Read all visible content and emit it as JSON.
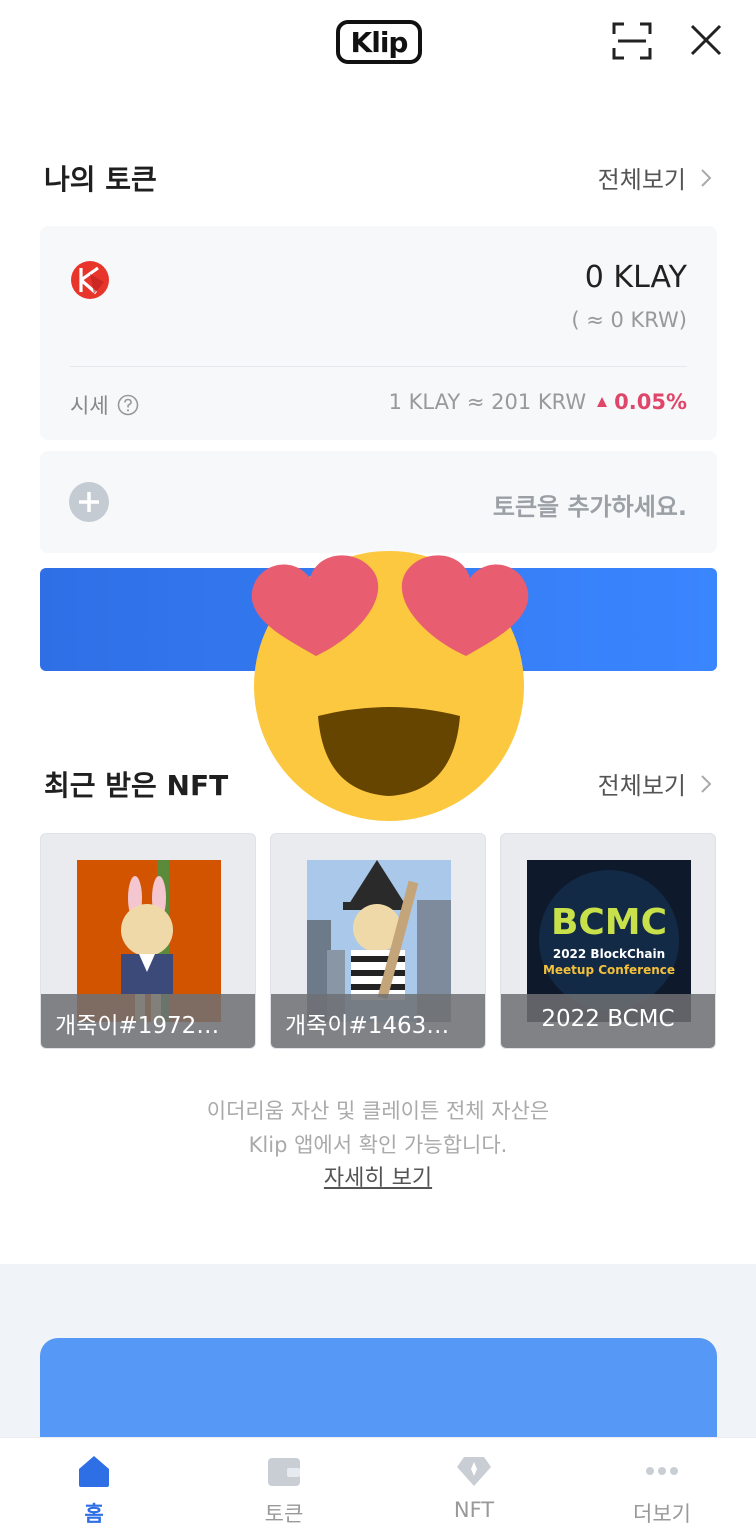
{
  "header": {
    "logo_text": "Klip",
    "scan_icon": "scan-frame-icon",
    "close_icon": "close-icon"
  },
  "tokens": {
    "title": "나의 토큰",
    "see_all": "전체보기",
    "klay": {
      "amount": "0 KLAY",
      "krw": "( ≈ 0 KRW)",
      "price_label": "시세",
      "price": "1 KLAY ≈ 201 KRW",
      "change": "0.05%",
      "change_color": "#e0456a"
    },
    "add_token": "토큰을 추가하세요."
  },
  "nft": {
    "title": "최근 받은 NFT",
    "see_all": "전체보기",
    "items": [
      {
        "caption": "개죽이#1972…"
      },
      {
        "caption": "개죽이#1463…"
      },
      {
        "caption": "2022 BCMC",
        "badge_line1": "BCMC",
        "badge_line2": "2022 BlockChain",
        "badge_line3": "Meetup Conference"
      }
    ]
  },
  "info": {
    "line1": "이더리움 자산 및 클레이튼 전체 자산은",
    "line2": "Klip 앱에서 확인 가능합니다.",
    "link": "자세히 보기"
  },
  "nav": {
    "items": [
      {
        "label": "홈",
        "icon": "home-icon",
        "active": true
      },
      {
        "label": "토큰",
        "icon": "wallet-icon",
        "active": false
      },
      {
        "label": "NFT",
        "icon": "diamond-icon",
        "active": false
      },
      {
        "label": "더보기",
        "icon": "more-dots-icon",
        "active": false
      }
    ]
  },
  "colors": {
    "accent_blue": "#2f6fe6",
    "banner_blue": "#5598f6"
  }
}
